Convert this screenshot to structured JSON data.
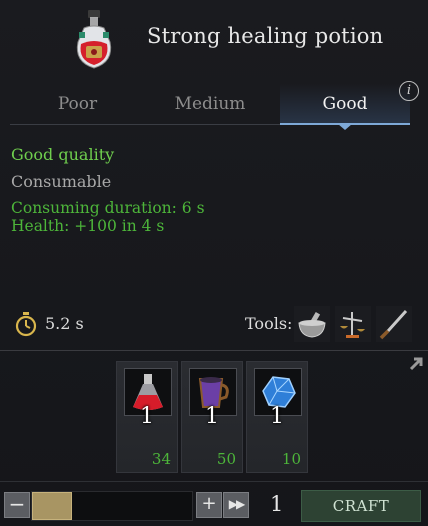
{
  "item": {
    "title": "Strong healing potion",
    "icon": "healing-potion-icon"
  },
  "tabs": [
    {
      "label": "Poor",
      "active": false
    },
    {
      "label": "Medium",
      "active": false
    },
    {
      "label": "Good",
      "active": true
    }
  ],
  "info_icon": "i",
  "details": {
    "quality": "Good quality",
    "category": "Consumable",
    "effects": [
      "Consuming duration: 6 s",
      "Health: +100 in 4 s"
    ]
  },
  "duration": {
    "icon": "stopwatch-icon",
    "value": "5.2 s"
  },
  "tools": {
    "label": "Tools:",
    "items": [
      {
        "name": "mortar-and-pestle-icon"
      },
      {
        "name": "scales-icon"
      },
      {
        "name": "knife-icon"
      }
    ]
  },
  "ingredients": [
    {
      "icon": "red-flask-icon",
      "required": "1",
      "owned": "34"
    },
    {
      "icon": "purple-mug-icon",
      "required": "1",
      "owned": "50"
    },
    {
      "icon": "blue-crystal-icon",
      "required": "1",
      "owned": "10"
    }
  ],
  "controls": {
    "minus": "−",
    "plus": "+",
    "max": "▶▶",
    "quantity": "1",
    "craft": "CRAFT"
  },
  "colors": {
    "quality_green": "#6fcf4e",
    "effect_green": "#4db53a",
    "accent_blue": "#7ea9d8",
    "craft_button": "#2d4233"
  }
}
